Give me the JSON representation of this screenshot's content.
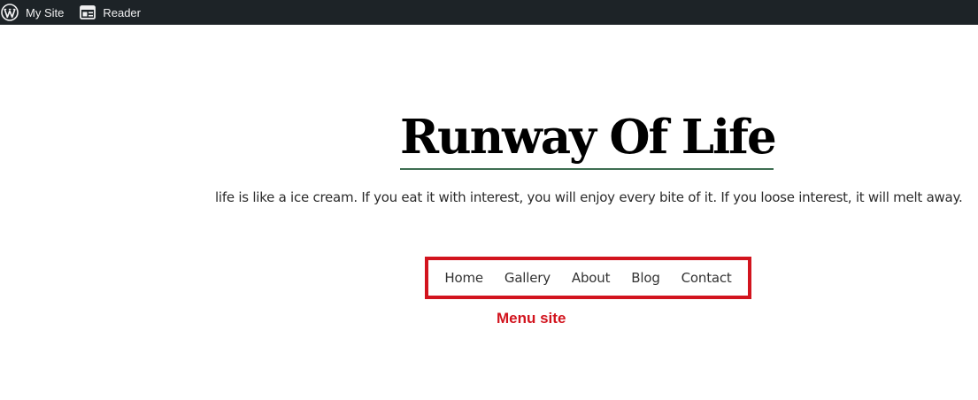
{
  "adminbar": {
    "items": [
      {
        "label": "My Site",
        "icon": "wordpress-logo-icon"
      },
      {
        "label": "Reader",
        "icon": "reader-icon"
      }
    ],
    "colors": {
      "background": "#1d2327",
      "text": "#f0f0f1"
    }
  },
  "site": {
    "title": "Runway Of Life",
    "tagline": "life is like a ice cream. If you eat it with interest, you will enjoy every bite of it. If you loose interest, it will melt away."
  },
  "menu": {
    "items": [
      "Home",
      "Gallery",
      "About",
      "Blog",
      "Contact"
    ]
  },
  "annotation": {
    "label": "Menu site",
    "color": "#d2141e"
  }
}
